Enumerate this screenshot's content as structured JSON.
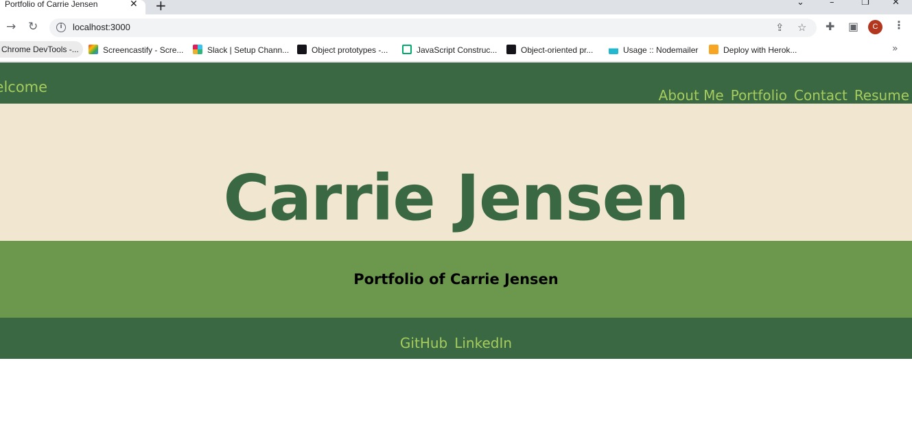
{
  "browser": {
    "tab_title": "Portfolio of Carrie Jensen",
    "url": "localhost:3000",
    "profile_initial": "C",
    "bookmarks": [
      "Chrome DevTools -...",
      "Screencastify - Scre...",
      "Slack | Setup Chann...",
      "Object prototypes -...",
      "JavaScript Construc...",
      "Object-oriented pr...",
      "Usage :: Nodemailer",
      "Deploy with Herok..."
    ]
  },
  "header": {
    "welcome": "Welcome",
    "nav": [
      "About Me",
      "Portfolio",
      "Contact",
      "Resume"
    ]
  },
  "hero": {
    "name": "Carrie Jensen"
  },
  "subtitle": "Portfolio of Carrie Jensen",
  "footer": {
    "links": [
      "GitHub",
      "LinkedIn"
    ]
  },
  "colors": {
    "header_bg": "#3a6842",
    "link_color": "#a7cc5e",
    "hero_bg": "#f1e7d0",
    "subtitle_bg": "#6b984c"
  }
}
